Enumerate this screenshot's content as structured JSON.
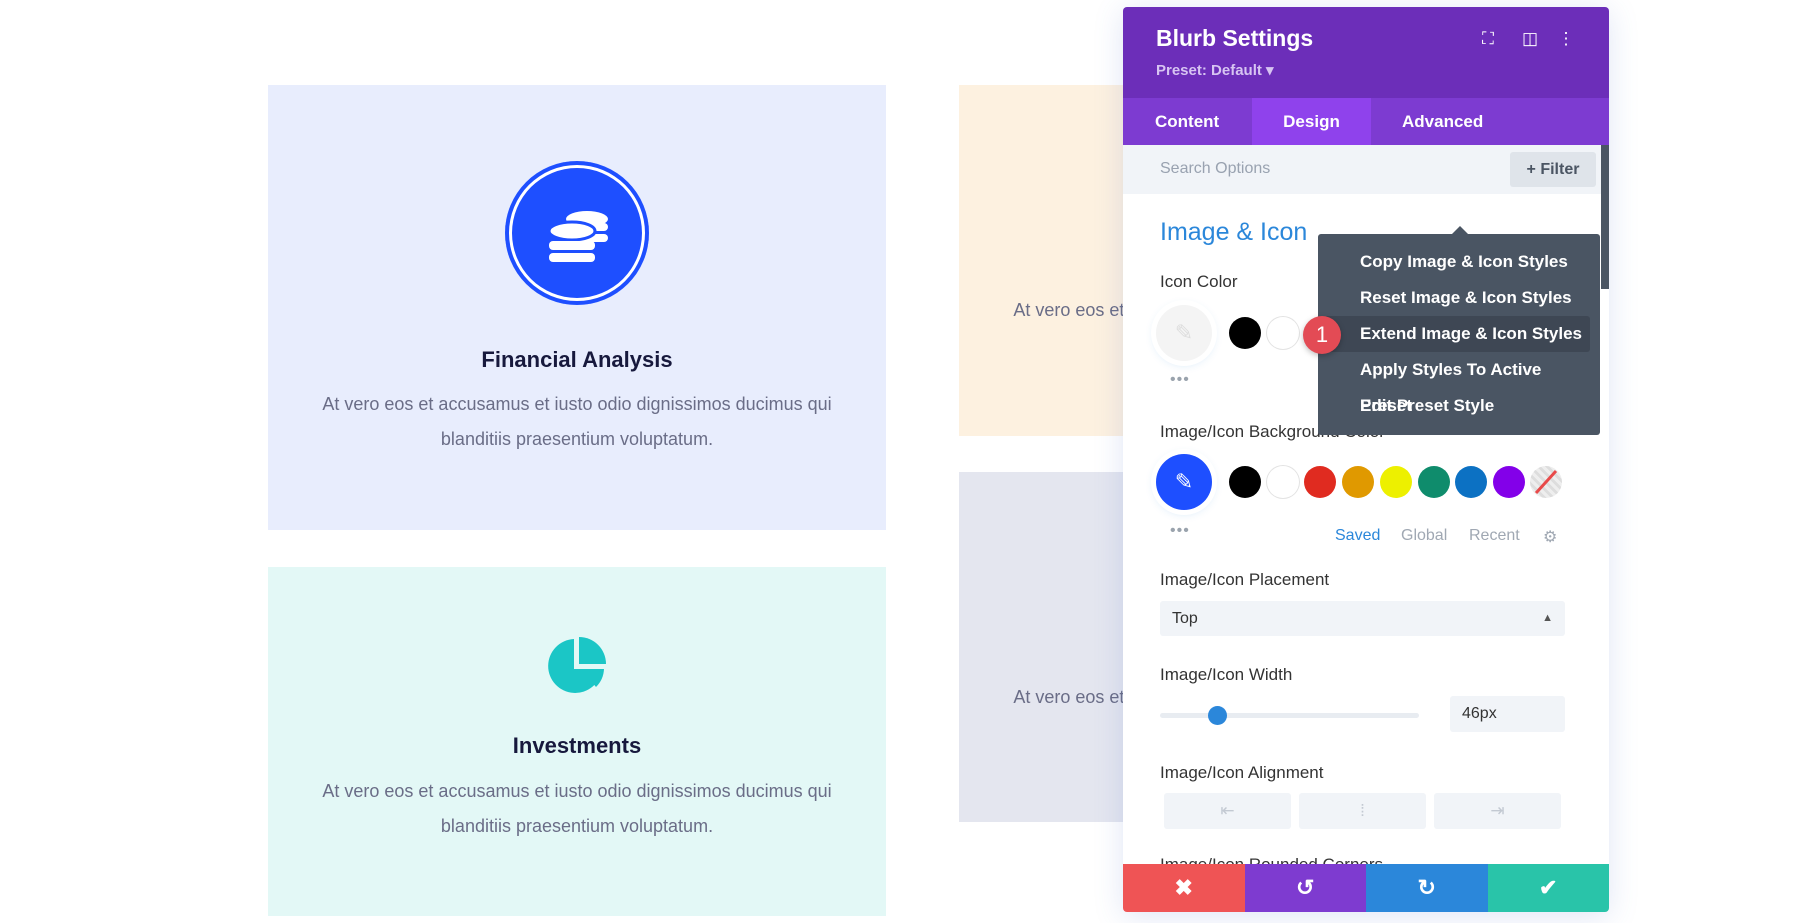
{
  "cards": [
    {
      "title": "Financial Analysis",
      "text": "At vero eos et accusamus et iusto odio dignissimos ducimus qui blanditiis praesentium voluptatum.",
      "bg": "#e8edfd",
      "icon": "coins-icon"
    },
    {
      "text": "At vero eos et accusamus et iusto odio dignissimos ducimus qui blanditiis praesentium voluptatum.",
      "bg": "#fdf1e0"
    },
    {
      "text": "At vero eos et accusamus et iusto odio dignissimos ducimus qui blanditiis praesentium voluptatum.",
      "bg": "#e4e6ef"
    },
    {
      "title": "Investments",
      "text": "At vero eos et accusamus et iusto odio dignissimos ducimus qui blanditiis praesentium voluptatum.",
      "bg": "#e3f8f6",
      "icon": "pie-chart-icon"
    }
  ],
  "panel": {
    "title": "Blurb Settings",
    "preset": "Preset: Default ▾",
    "tabs": [
      "Content",
      "Design",
      "Advanced"
    ],
    "active_tab": "Design",
    "search_placeholder": "Search Options",
    "filter": "+ Filter",
    "section": "Image & Icon",
    "icon_color_label": "Icon Color",
    "bg_color_label": "Image/Icon Background Color",
    "swatches": [
      "#000000",
      "#ffffff",
      "#e02b20",
      "#e09900",
      "#edf000",
      "#0f8c6c",
      "#0c71c3",
      "#8300e9"
    ],
    "palette_tabs": [
      "Saved",
      "Global",
      "Recent"
    ],
    "placement_label": "Image/Icon Placement",
    "placement_value": "Top",
    "width_label": "Image/Icon Width",
    "width_value": "46px",
    "width_slider_fraction": 0.22,
    "alignment_label": "Image/Icon Alignment",
    "next_label": "Image/Icon Rounded Corners"
  },
  "menu": {
    "items": [
      "Copy Image & Icon Styles",
      "Reset Image & Icon Styles",
      "Extend Image & Icon Styles",
      "Apply Styles To Active Preset",
      "Edit Preset Style"
    ],
    "highlighted": 2,
    "badge": "1"
  },
  "colors": {
    "accent": "#2b87da",
    "header": "#6c2eb9",
    "icon_blue": "#1e4fff",
    "teal": "#1bc6c6",
    "cancel": "#ef5455",
    "undo": "#7e3bd0",
    "redo": "#2b87da",
    "save": "#29c4a9"
  }
}
